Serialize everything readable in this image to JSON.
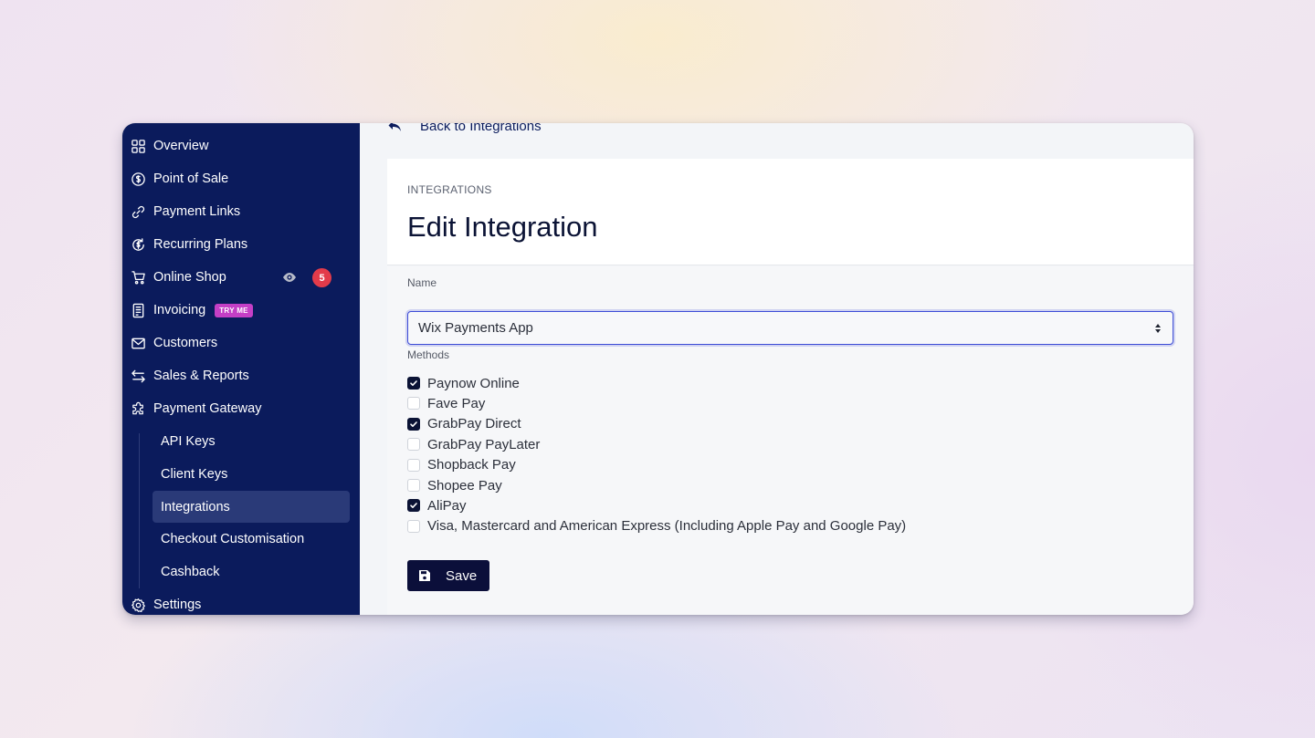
{
  "sidebar": {
    "items": [
      {
        "label": "Overview",
        "icon": "grid-icon"
      },
      {
        "label": "Point of Sale",
        "icon": "dollar-circle-icon"
      },
      {
        "label": "Payment Links",
        "icon": "link-icon"
      },
      {
        "label": "Recurring Plans",
        "icon": "recurring-icon"
      },
      {
        "label": "Online Shop",
        "icon": "cart-icon",
        "badge_count": "5"
      },
      {
        "label": "Invoicing",
        "icon": "invoice-icon",
        "badge": "TRY ME"
      },
      {
        "label": "Customers",
        "icon": "mail-icon"
      },
      {
        "label": "Sales & Reports",
        "icon": "swap-arrows-icon"
      },
      {
        "label": "Payment Gateway",
        "icon": "puzzle-icon"
      }
    ],
    "sub_items": [
      {
        "label": "API Keys",
        "active": false
      },
      {
        "label": "Client Keys",
        "active": false
      },
      {
        "label": "Integrations",
        "active": true
      },
      {
        "label": "Checkout Customisation",
        "active": false
      },
      {
        "label": "Cashback",
        "active": false
      }
    ],
    "settings": {
      "label": "Settings",
      "icon": "gear-icon"
    }
  },
  "main": {
    "back_label": "Back to Integrations",
    "breadcrumb": "INTEGRATIONS",
    "title": "Edit Integration",
    "name_label": "Name",
    "name_value": "Wix Payments App",
    "methods_label": "Methods",
    "methods": [
      {
        "label": "Paynow Online",
        "checked": true
      },
      {
        "label": "Fave Pay",
        "checked": false
      },
      {
        "label": "GrabPay Direct",
        "checked": true
      },
      {
        "label": "GrabPay PayLater",
        "checked": false
      },
      {
        "label": "Shopback Pay",
        "checked": false
      },
      {
        "label": "Shopee Pay",
        "checked": false
      },
      {
        "label": "AliPay",
        "checked": true
      },
      {
        "label": "Visa, Mastercard and American Express (Including Apple Pay and Google Pay)",
        "checked": false
      }
    ],
    "save_label": "Save"
  },
  "colors": {
    "sidebar_bg": "#0b1b5c",
    "active_sub_bg": "#2a3a78",
    "try_badge": "#c43fc6",
    "count_badge": "#e33b4a",
    "save_button": "#0b0f3a",
    "focus_border": "#3d4cd6"
  }
}
